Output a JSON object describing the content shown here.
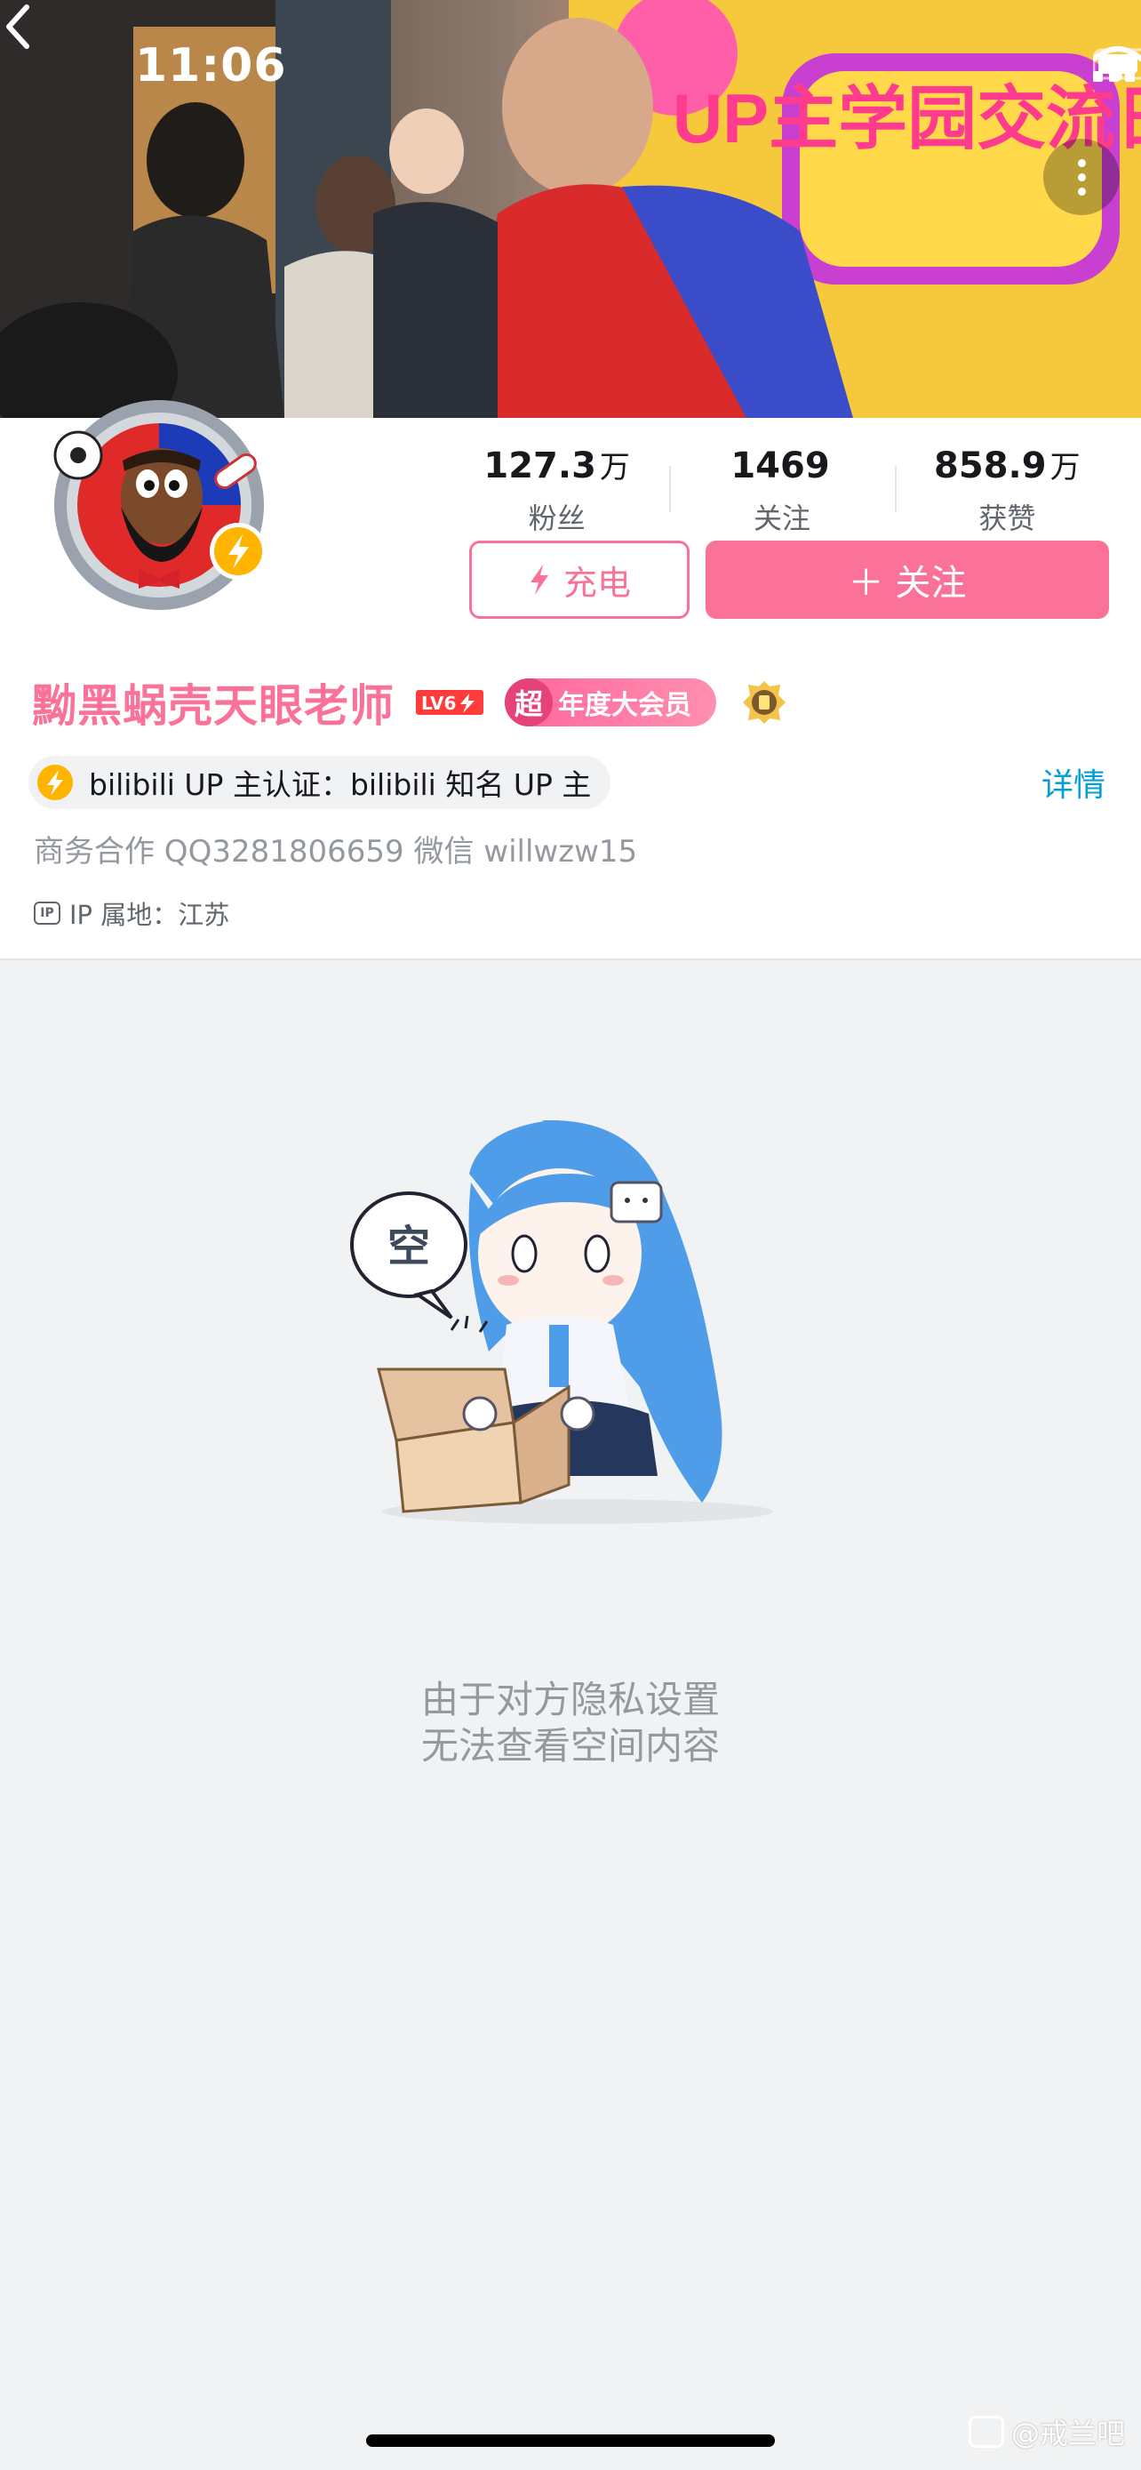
{
  "status_bar": {
    "time": "11:06"
  },
  "header": {
    "back_icon": "chevron-left-icon",
    "more_icon": "more-vertical-icon",
    "banner_text": "UP主学园交流日"
  },
  "profile": {
    "stats": [
      {
        "value": "127.3",
        "unit": "万",
        "label": "粉丝"
      },
      {
        "value": "1469",
        "unit": "",
        "label": "关注"
      },
      {
        "value": "858.9",
        "unit": "万",
        "label": "获赞"
      }
    ],
    "charge_label": "充电",
    "follow_label": "＋ 关注",
    "username": "黝黑蜗壳天眼老师",
    "level": "LV6",
    "vip_icon_text": "超",
    "vip_label": "年度大会员",
    "verification": "bilibili UP 主认证：bilibili 知名 UP 主",
    "detail_link": "详情",
    "signature": "商务合作 QQ3281806659 微信 willwzw15",
    "ip_tag": "IP",
    "ip_location": "IP 属地：江苏"
  },
  "empty_state": {
    "bubble_text": "空",
    "line1": "由于对方隐私设置",
    "line2": "无法查看空间内容"
  },
  "watermark": "@戒兰吧",
  "colors": {
    "brand_pink": "#fb7299",
    "link_blue": "#00a1d6",
    "bg_gray": "#f1f2f3"
  }
}
